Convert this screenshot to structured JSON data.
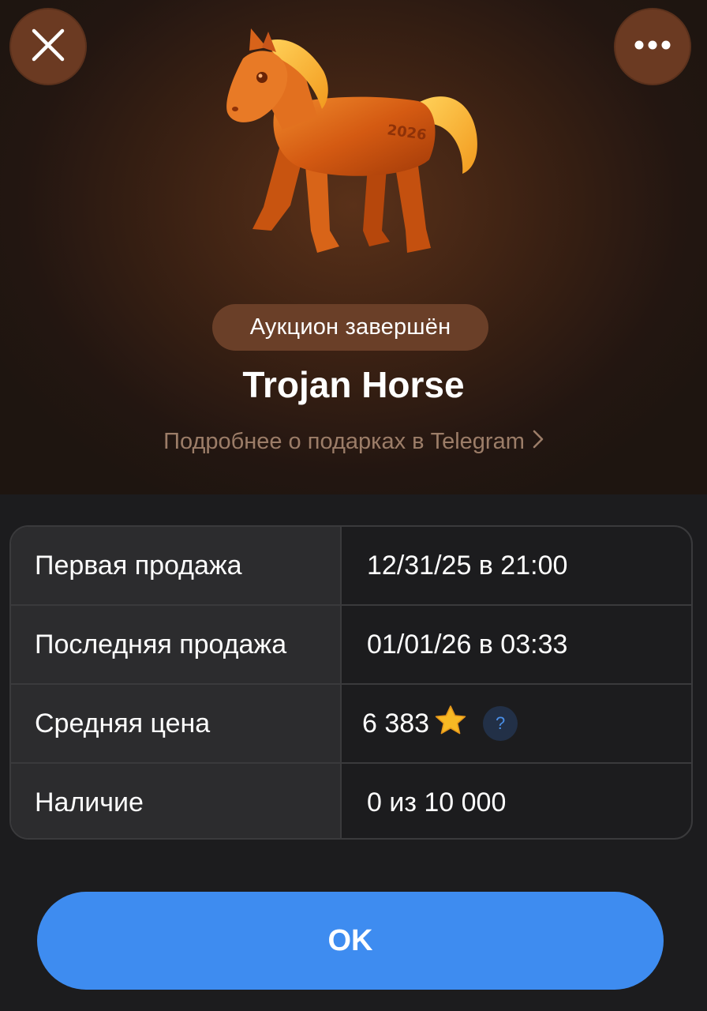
{
  "header": {
    "close_icon": "close-icon",
    "more_icon": "more-horizontal-icon",
    "gift_image": "trojan-horse-figurine",
    "gift_engraving": "2026"
  },
  "gift": {
    "status_badge": "Аукцион завершён",
    "title": "Trojan Horse",
    "more_link": "Подробнее о подарках в Telegram"
  },
  "details": {
    "rows": [
      {
        "label": "Первая продажа",
        "value": "12/31/25 в 21:00"
      },
      {
        "label": "Последняя продажа",
        "value": "01/01/26 в 03:33"
      },
      {
        "label": "Средняя цена",
        "value": "6 383",
        "icon": "star-icon",
        "help": "?"
      },
      {
        "label": "Наличие",
        "value": "0 из 10 000"
      }
    ]
  },
  "footer": {
    "ok_label": "OK"
  },
  "colors": {
    "accent": "#3e8cf0",
    "badge_bg": "#6a3f28",
    "star": "#f7b924"
  }
}
